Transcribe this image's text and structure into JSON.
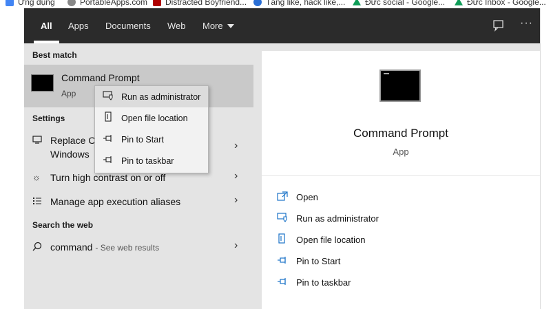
{
  "bookmarks": [
    {
      "label": "Ứng dụng",
      "color": "#4285f4"
    },
    {
      "label": "PortableApps.com",
      "color": "#888888"
    },
    {
      "label": "Distracted Boyfriend...",
      "color": "#b00000"
    },
    {
      "label": "Tăng like, hack like,...",
      "color": "#2a6fd6"
    },
    {
      "label": "Đức social - Google...",
      "color": "#0f9d58"
    },
    {
      "label": "Đức Inbox - Google...",
      "color": "#0f9d58"
    }
  ],
  "tabs": {
    "all": "All",
    "apps": "Apps",
    "documents": "Documents",
    "web": "Web",
    "more": "More"
  },
  "left": {
    "best_match_heading": "Best match",
    "best_match": {
      "title": "Command Prompt",
      "subtitle": "App"
    },
    "settings_heading": "Settings",
    "settings": [
      {
        "label_line1": "Replace C",
        "label_line2": "Windows"
      },
      {
        "label": "Turn high contrast on or off"
      },
      {
        "label": "Manage app execution aliases"
      }
    ],
    "web_heading": "Search the web",
    "web_result": {
      "query": "command",
      "suffix": "- See web results"
    }
  },
  "context_menu": [
    {
      "label": "Run as administrator",
      "icon": "shield-icon"
    },
    {
      "label": "Open file location",
      "icon": "folder-icon"
    },
    {
      "label": "Pin to Start",
      "icon": "pin-icon"
    },
    {
      "label": "Pin to taskbar",
      "icon": "pin-icon"
    }
  ],
  "right": {
    "title": "Command Prompt",
    "subtitle": "App",
    "actions": [
      {
        "label": "Open",
        "icon": "open-icon"
      },
      {
        "label": "Run as administrator",
        "icon": "shield-icon"
      },
      {
        "label": "Open file location",
        "icon": "folder-icon"
      },
      {
        "label": "Pin to Start",
        "icon": "pin-icon"
      },
      {
        "label": "Pin to taskbar",
        "icon": "pin-icon"
      }
    ]
  },
  "colors": {
    "topbar": "#2b2b2b",
    "panel": "#e4e4e4",
    "selected": "#c9c9c9",
    "accent": "#1a73c8"
  }
}
